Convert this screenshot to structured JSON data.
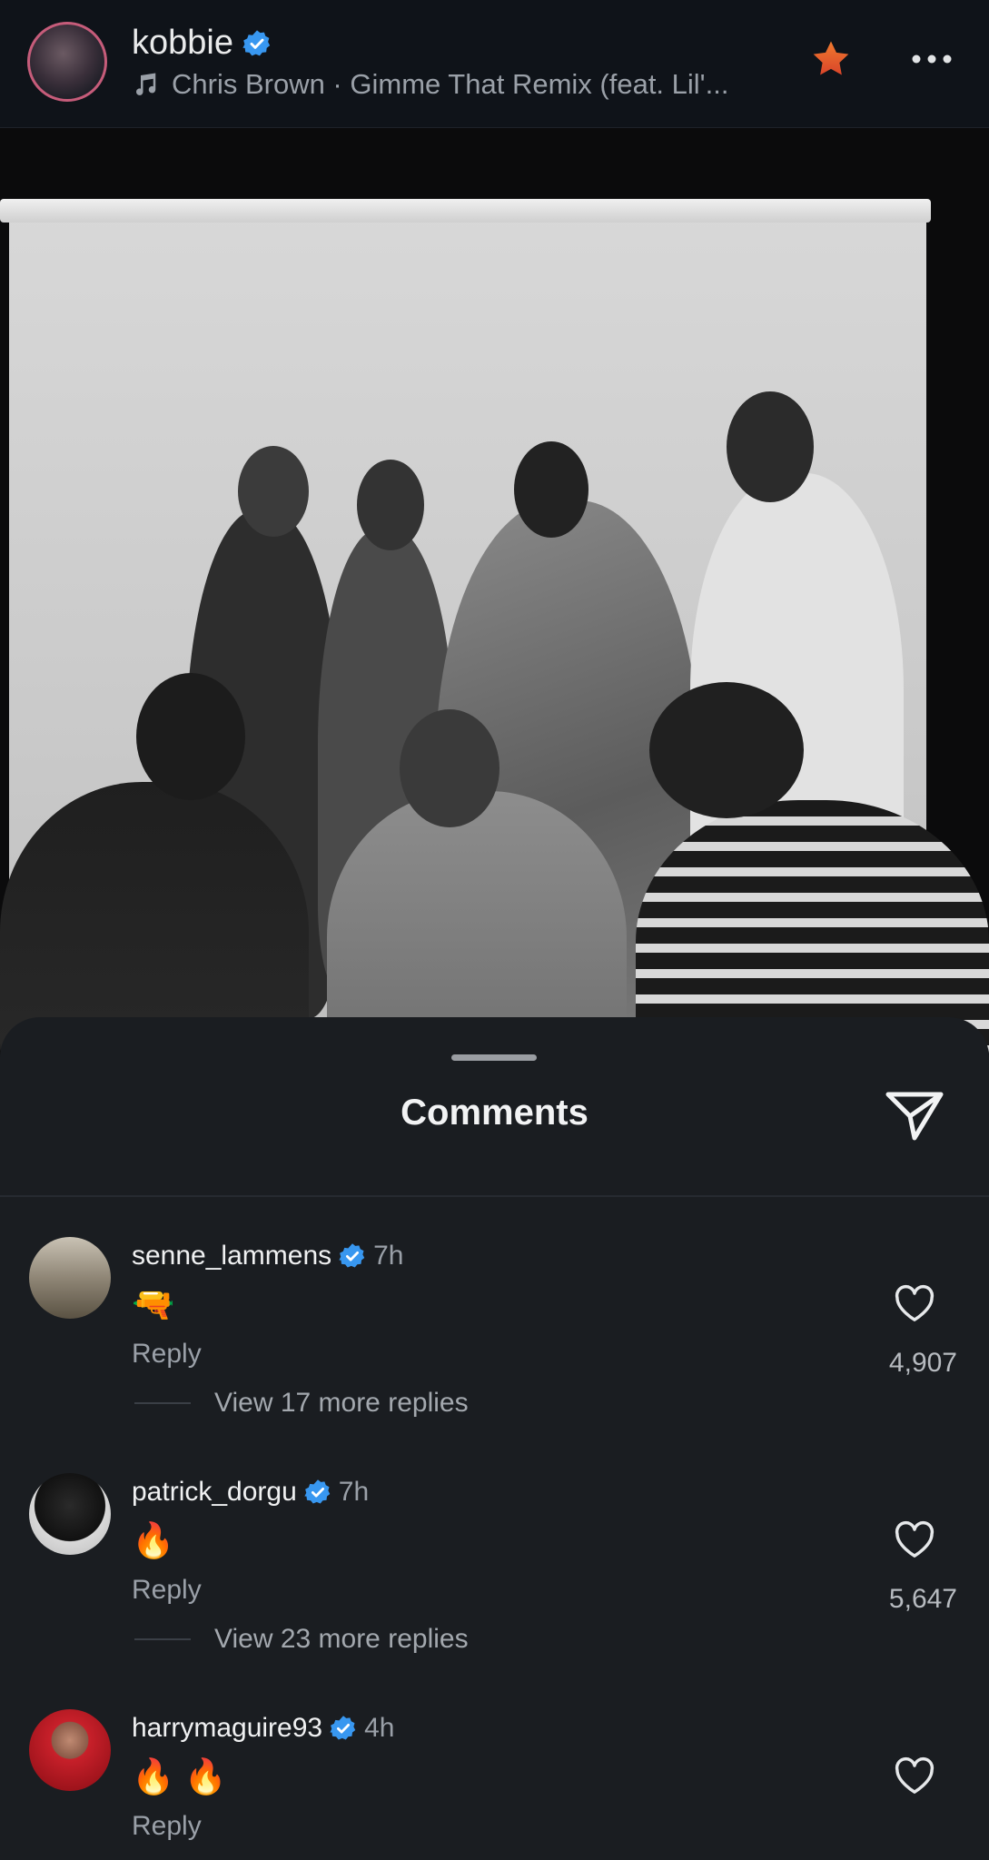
{
  "header": {
    "username": "kobbie",
    "song": "Chris Brown · Gimme That Remix (feat. Lil'..."
  },
  "sheet": {
    "title": "Comments"
  },
  "comments": [
    {
      "username": "senne_lammens",
      "time": "7h",
      "text": "🔫",
      "reply_label": "Reply",
      "likes": "4,907",
      "view_more": "View 17 more replies"
    },
    {
      "username": "patrick_dorgu",
      "time": "7h",
      "text": "🔥",
      "reply_label": "Reply",
      "likes": "5,647",
      "view_more": "View 23 more replies"
    },
    {
      "username": "harrymaguire93",
      "time": "4h",
      "text": "🔥 🔥",
      "reply_label": "Reply",
      "likes": "",
      "view_more": ""
    }
  ],
  "colors": {
    "verified": "#3897f0",
    "star": "#e8622c",
    "background": "#15181c",
    "sheet": "#1a1d21"
  },
  "icons": [
    "music-note-icon",
    "verified-badge-icon",
    "star-icon",
    "more-options-icon",
    "share-send-icon",
    "heart-icon"
  ]
}
